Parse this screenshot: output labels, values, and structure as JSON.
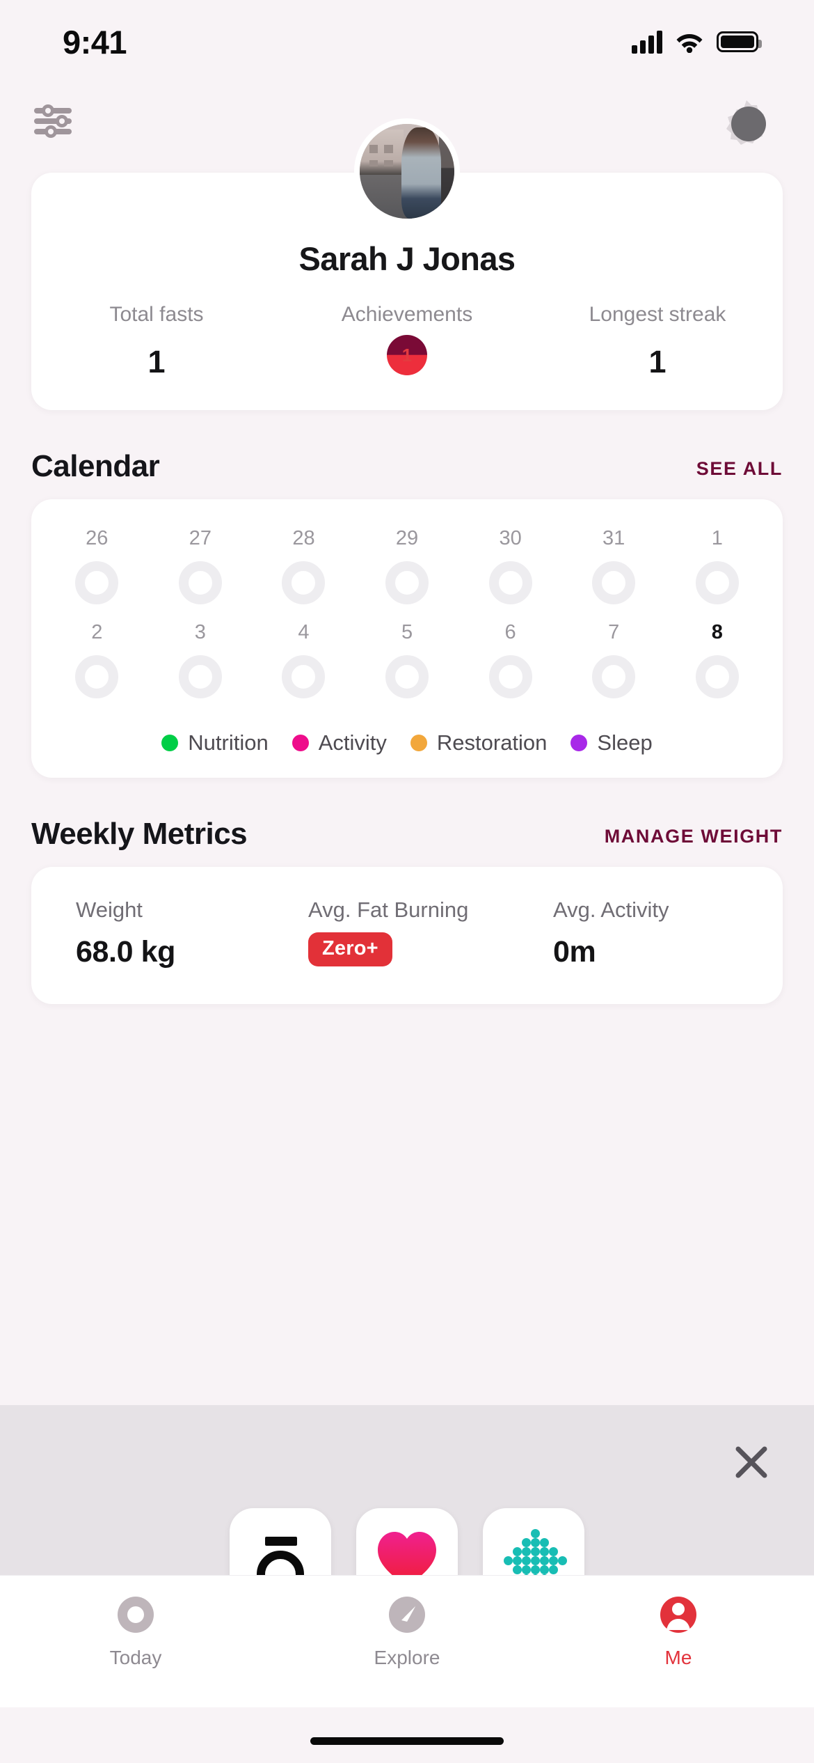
{
  "status_bar": {
    "time": "9:41",
    "signal_icon": "cellular-signal-icon",
    "wifi_icon": "wifi-icon",
    "battery_icon": "battery-icon"
  },
  "top_bar": {
    "filters_icon": "sliders-icon",
    "settings_icon": "gear-icon"
  },
  "profile": {
    "avatar_name": "user-avatar",
    "name": "Sarah J Jonas",
    "stats": [
      {
        "label": "Total fasts",
        "value": "1",
        "type": "number"
      },
      {
        "label": "Achievements",
        "value": "1",
        "type": "badge"
      },
      {
        "label": "Longest streak",
        "value": "1",
        "type": "number"
      }
    ]
  },
  "calendar": {
    "title": "Calendar",
    "action": "SEE ALL",
    "weeks": [
      [
        {
          "day": "26",
          "today": false
        },
        {
          "day": "27",
          "today": false
        },
        {
          "day": "28",
          "today": false
        },
        {
          "day": "29",
          "today": false
        },
        {
          "day": "30",
          "today": false
        },
        {
          "day": "31",
          "today": false
        },
        {
          "day": "1",
          "today": false
        }
      ],
      [
        {
          "day": "2",
          "today": false
        },
        {
          "day": "3",
          "today": false
        },
        {
          "day": "4",
          "today": false
        },
        {
          "day": "5",
          "today": false
        },
        {
          "day": "6",
          "today": false
        },
        {
          "day": "7",
          "today": false
        },
        {
          "day": "8",
          "today": true
        }
      ]
    ],
    "legend": [
      {
        "label": "Nutrition",
        "color": "#00CE46"
      },
      {
        "label": "Activity",
        "color": "#EE0D8B"
      },
      {
        "label": "Restoration",
        "color": "#F2A73B"
      },
      {
        "label": "Sleep",
        "color": "#A828E8"
      }
    ]
  },
  "weekly_metrics": {
    "title": "Weekly Metrics",
    "action": "MANAGE WEIGHT",
    "items": [
      {
        "label": "Weight",
        "value": "68.0 kg",
        "type": "text"
      },
      {
        "label": "Avg. Fat Burning",
        "value": "Zero+",
        "type": "badge",
        "badge_color": "#E23138"
      },
      {
        "label": "Avg. Activity",
        "value": "0m",
        "type": "text"
      }
    ]
  },
  "app_switcher": {
    "close_icon": "close-icon",
    "apps": [
      {
        "name": "zero-app-icon",
        "icon": "zero-ring-icon"
      },
      {
        "name": "health-app-icon",
        "icon": "heart-icon"
      },
      {
        "name": "dots-app-icon",
        "icon": "dot-grid-icon"
      }
    ]
  },
  "tab_bar": {
    "tabs": [
      {
        "label": "Today",
        "icon": "ring-icon",
        "active": false
      },
      {
        "label": "Explore",
        "icon": "compass-icon",
        "active": false
      },
      {
        "label": "Me",
        "icon": "person-icon",
        "active": true
      }
    ],
    "active_color": "#E2323B",
    "inactive_color": "#BEB5BA"
  }
}
